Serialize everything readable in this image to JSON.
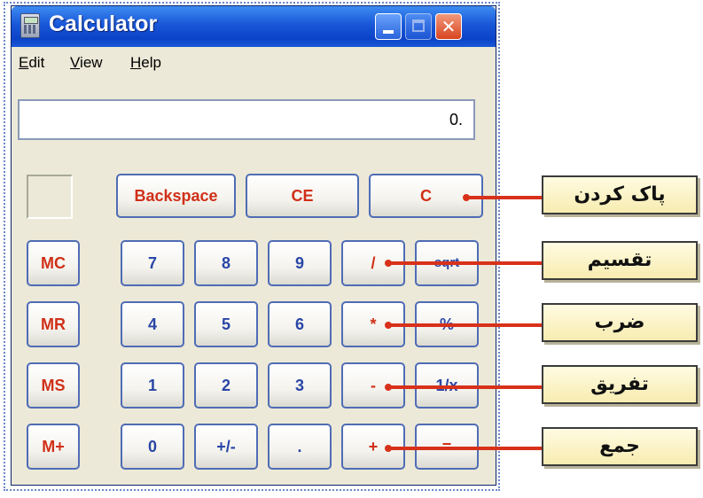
{
  "window": {
    "title": "Calculator"
  },
  "menu": [
    "Edit",
    "View",
    "Help"
  ],
  "display": {
    "value": "0."
  },
  "keys": {
    "backspace": "Backspace",
    "ce": "CE",
    "c": "C",
    "mc": "MC",
    "mr": "MR",
    "ms": "MS",
    "mplus": "M+",
    "d7": "7",
    "d8": "8",
    "d9": "9",
    "divide": "/",
    "sqrt": "sqrt",
    "d4": "4",
    "d5": "5",
    "d6": "6",
    "multiply": "*",
    "percent": "%",
    "d1": "1",
    "d2": "2",
    "d3": "3",
    "subtract": "-",
    "reciprocal": "1/x",
    "d0": "0",
    "plusminus": "+/-",
    "decimal": ".",
    "add": "+",
    "equals": "="
  },
  "labels": {
    "clear": "پاک کردن",
    "divide": "تقسیم",
    "multiply": "ضرب",
    "subtract": "تفریق",
    "add": "جمع"
  },
  "colors": {
    "annotation_line": "#d8311a",
    "label_bg": "#fbf3c4",
    "key_red": "#d03018",
    "key_blue": "#2a46a6"
  }
}
